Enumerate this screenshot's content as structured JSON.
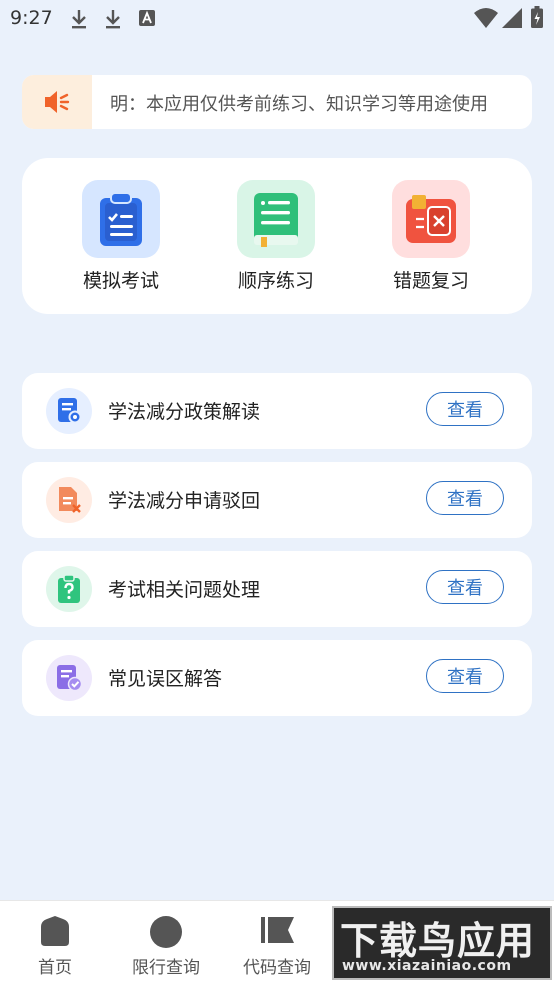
{
  "status_bar": {
    "time": "9:27"
  },
  "notice": {
    "text": "明：本应用仅供考前练习、知识学习等用途使用"
  },
  "quick_actions": [
    {
      "label": "模拟考试",
      "icon": "exam-clipboard-icon",
      "color": "#2f6fe8",
      "tile_bg": "#d6e6ff"
    },
    {
      "label": "顺序练习",
      "icon": "practice-book-icon",
      "color": "#2fbf7a",
      "tile_bg": "#d9f5e7"
    },
    {
      "label": "错题复习",
      "icon": "wrong-questions-icon",
      "color": "#f0533f",
      "tile_bg": "#ffdede"
    }
  ],
  "info_items": [
    {
      "title": "学法减分政策解读",
      "button": "查看",
      "icon": "policy-document-icon",
      "color": "#2f6fe8",
      "circle_bg": "#e6efff"
    },
    {
      "title": "学法减分申请驳回",
      "button": "查看",
      "icon": "rejected-document-icon",
      "color": "#f28a5c",
      "circle_bg": "#ffece3"
    },
    {
      "title": "考试相关问题处理",
      "button": "查看",
      "icon": "question-clipboard-icon",
      "color": "#2fc47e",
      "circle_bg": "#dff6ea"
    },
    {
      "title": "常见误区解答",
      "button": "查看",
      "icon": "check-document-icon",
      "color": "#8b6ee6",
      "circle_bg": "#eee8fc"
    }
  ],
  "bottom_nav": [
    {
      "label": "首页",
      "icon": "home-icon"
    },
    {
      "label": "限行查询",
      "icon": "restriction-icon"
    },
    {
      "label": "代码查询",
      "icon": "flag-icon"
    },
    {
      "label": "",
      "icon": "study-icon"
    },
    {
      "label": "",
      "icon": "profile-icon"
    }
  ],
  "watermark": {
    "title": "下载鸟应用",
    "url": "www.xiazainiao.com"
  },
  "colors": {
    "background": "#eaf1fb",
    "accent": "#2f72c4",
    "notice_icon": "#f0632a"
  }
}
